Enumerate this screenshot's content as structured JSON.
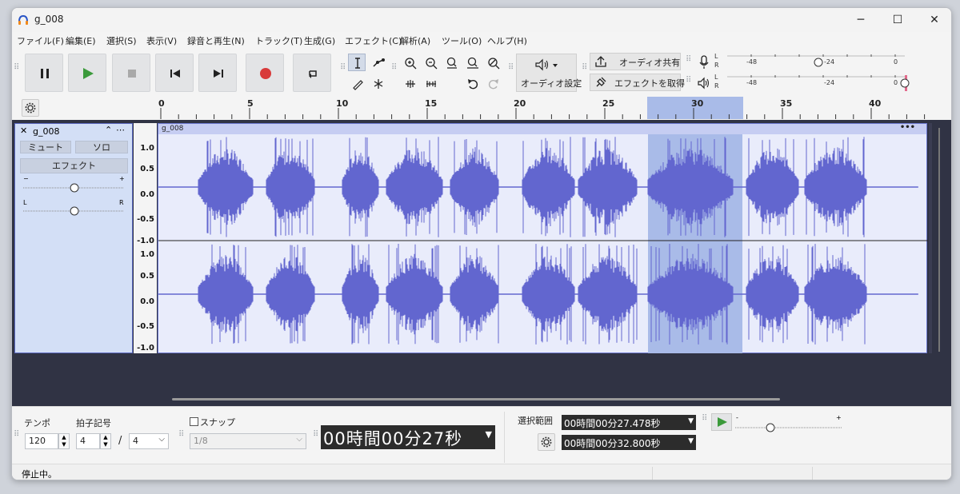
{
  "window": {
    "title": "g_008",
    "minimize": "─",
    "maximize": "☐",
    "close": "✕"
  },
  "menu": [
    "ファイル(F)",
    "編集(E)",
    "選択(S)",
    "表示(V)",
    "録音と再生(N)",
    "トラック(T)",
    "生成(G)",
    "エフェクト(C)",
    "解析(A)",
    "ツール(O)",
    "ヘルプ(H)"
  ],
  "toolbar": {
    "audio_settings_label": "オーディオ設定",
    "share_audio_label": "オーディオ共有",
    "get_effects_label": "エフェクトを取得",
    "meter_ticks": [
      "-48",
      "-24",
      "0"
    ],
    "meter_channels": [
      "L",
      "R"
    ]
  },
  "ruler": {
    "ticks": [
      "0",
      "5",
      "10",
      "15",
      "20",
      "25",
      "30",
      "35",
      "40"
    ]
  },
  "track": {
    "name": "g_008",
    "mute_label": "ミュート",
    "solo_label": "ソロ",
    "effects_label": "エフェクト",
    "gain_minus": "−",
    "gain_plus": "+",
    "pan_left": "L",
    "pan_right": "R",
    "clip_name": "g_008",
    "clip_menu": "•••",
    "scale_labels": [
      "1.0",
      "0.5",
      "0.0",
      "-0.5",
      "-1.0"
    ]
  },
  "bottom": {
    "tempo_label": "テンポ",
    "tempo_value": "120",
    "time_sig_label": "拍子記号",
    "time_sig_num": "4",
    "time_sig_sep": "/",
    "time_sig_den": "4",
    "snap_label": "スナップ",
    "snap_value": "1/8",
    "time_display": "00時間00分27秒",
    "selection_label": "選択範囲",
    "selection_start": "00時間00分27.478秒",
    "selection_end": "00時間00分32.800秒",
    "speed_minus": "-",
    "speed_plus": "+"
  },
  "status": {
    "text": "停止中。"
  },
  "colors": {
    "waveform": "#6266cf",
    "selection": "#a9bbe8",
    "track_bg": "#303344",
    "clip_bg": "#e9ecfb",
    "record": "#d83a3a",
    "play": "#3b9a3b"
  }
}
